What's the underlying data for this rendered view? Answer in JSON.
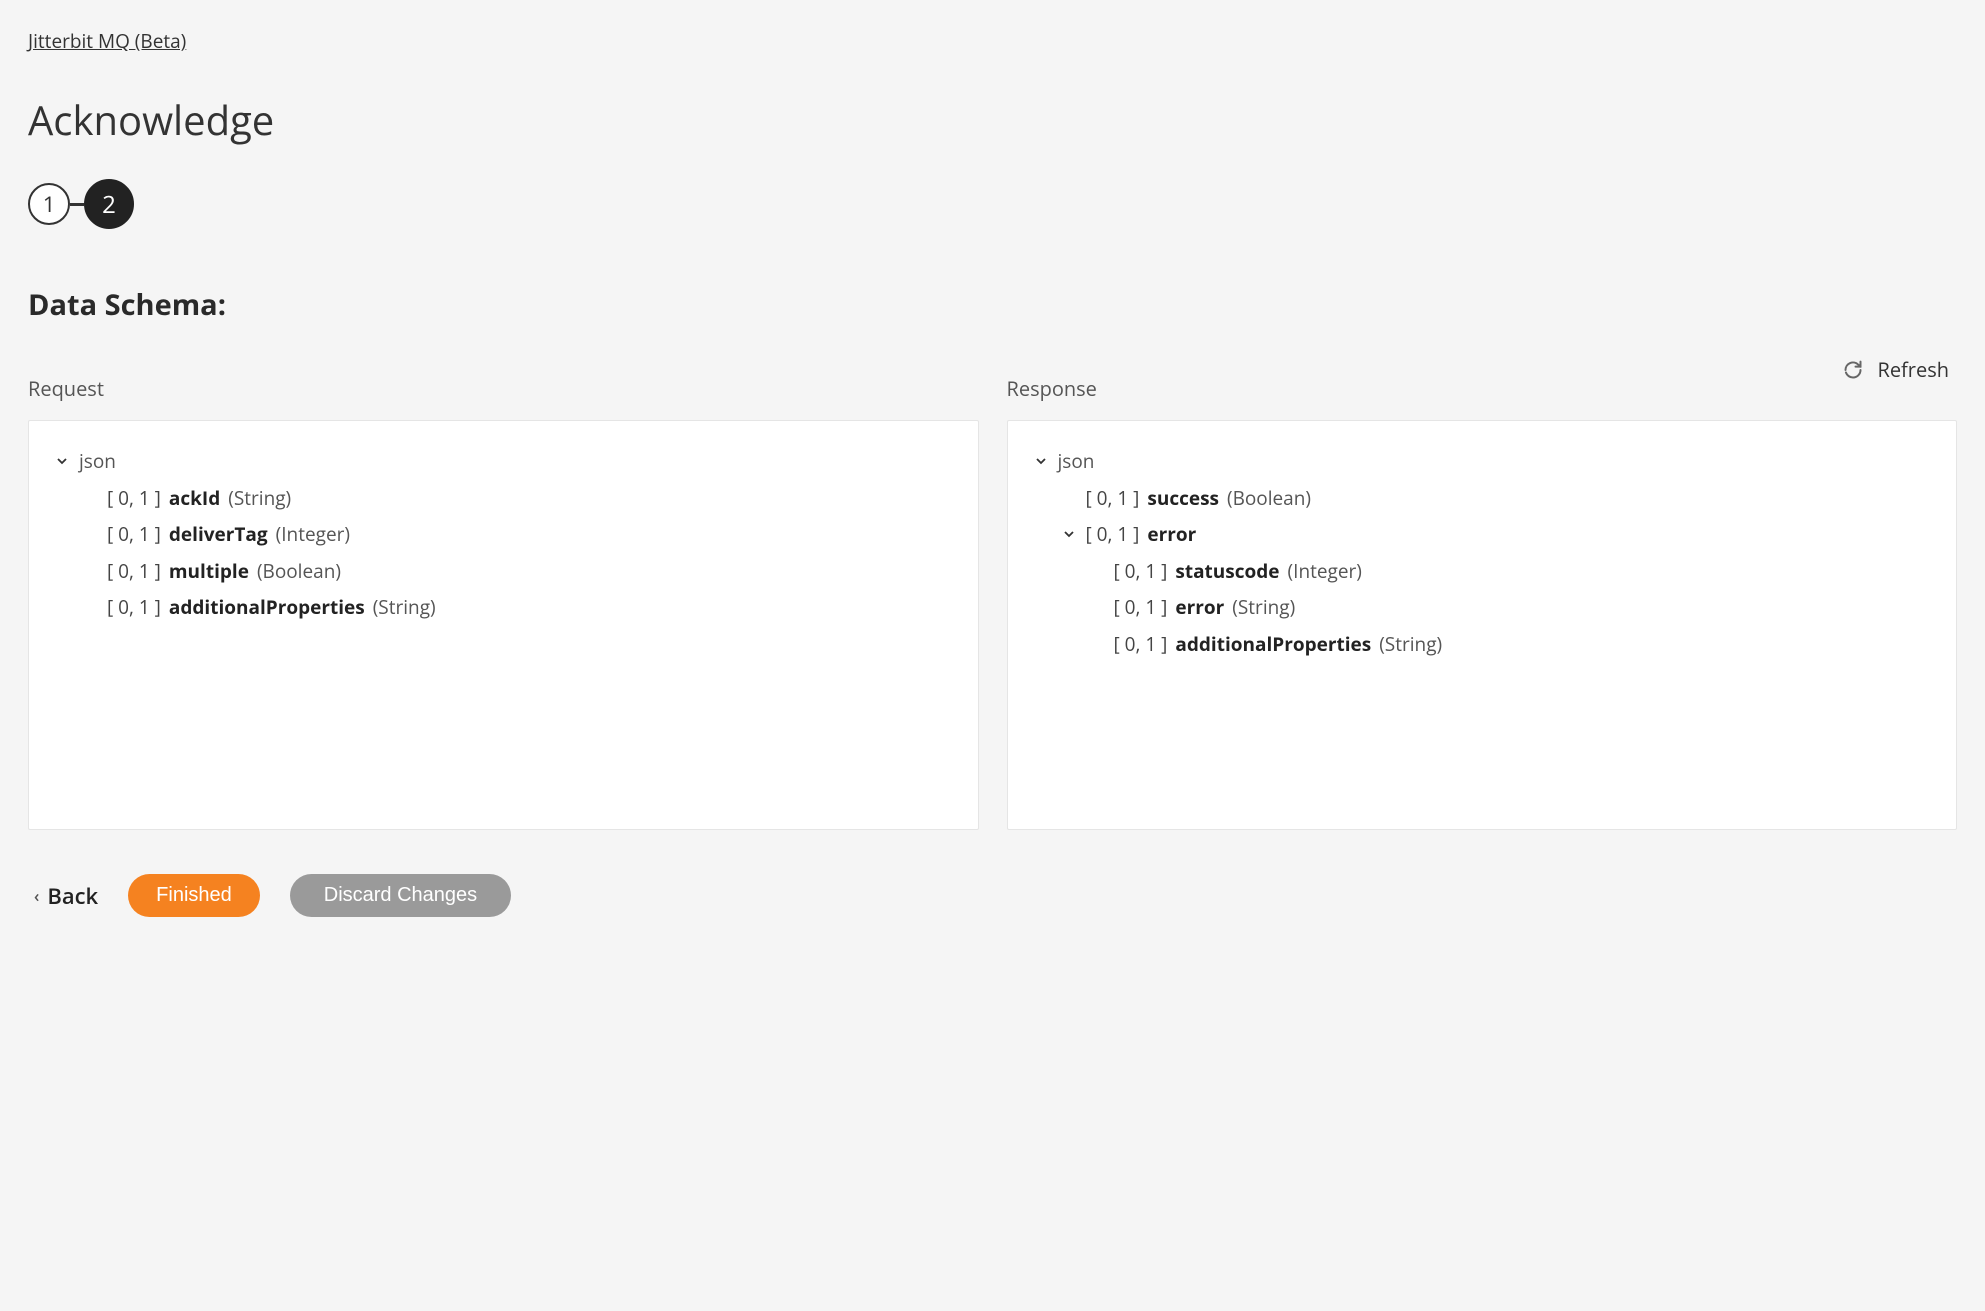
{
  "breadcrumb": "Jitterbit MQ (Beta)",
  "page_title": "Acknowledge",
  "stepper": {
    "step1": "1",
    "step2": "2"
  },
  "section_title": "Data Schema:",
  "refresh_label": "Refresh",
  "request": {
    "label": "Request",
    "root": "json",
    "fields": [
      {
        "cardinality": "[ 0, 1 ]",
        "name": "ackId",
        "type": "(String)"
      },
      {
        "cardinality": "[ 0, 1 ]",
        "name": "deliverTag",
        "type": "(Integer)"
      },
      {
        "cardinality": "[ 0, 1 ]",
        "name": "multiple",
        "type": "(Boolean)"
      },
      {
        "cardinality": "[ 0, 1 ]",
        "name": "additionalProperties",
        "type": "(String)"
      }
    ]
  },
  "response": {
    "label": "Response",
    "root": "json",
    "success": {
      "cardinality": "[ 0, 1 ]",
      "name": "success",
      "type": "(Boolean)"
    },
    "error_node": {
      "cardinality": "[ 0, 1 ]",
      "name": "error"
    },
    "error_children": [
      {
        "cardinality": "[ 0, 1 ]",
        "name": "statuscode",
        "type": "(Integer)"
      },
      {
        "cardinality": "[ 0, 1 ]",
        "name": "error",
        "type": "(String)"
      },
      {
        "cardinality": "[ 0, 1 ]",
        "name": "additionalProperties",
        "type": "(String)"
      }
    ]
  },
  "footer": {
    "back": "Back",
    "finished": "Finished",
    "discard": "Discard Changes"
  }
}
